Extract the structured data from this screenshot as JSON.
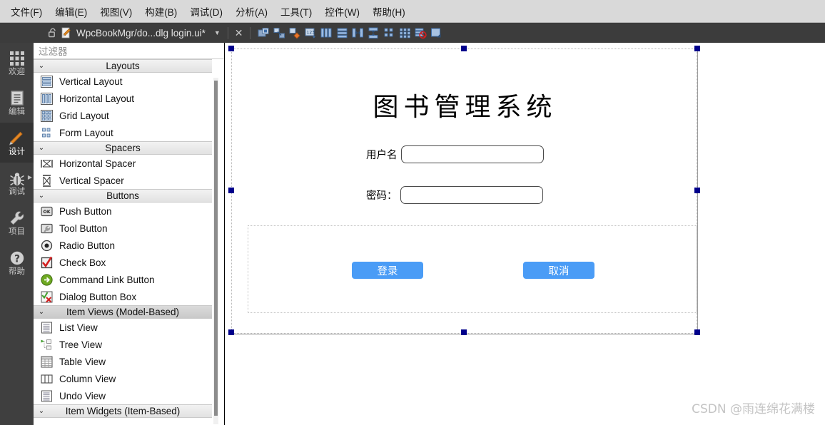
{
  "menubar": [
    {
      "label": "文件(F)"
    },
    {
      "label": "编辑(E)"
    },
    {
      "label": "视图(V)"
    },
    {
      "label": "构建(B)"
    },
    {
      "label": "调试(D)"
    },
    {
      "label": "分析(A)"
    },
    {
      "label": "工具(T)"
    },
    {
      "label": "控件(W)"
    },
    {
      "label": "帮助(H)"
    }
  ],
  "tabbar": {
    "lock_icon": "unlocked-padlock-icon",
    "doc_icon": "edit-document-icon",
    "tab_title": "WpcBookMgr/do...dlg  login.ui*",
    "dropdown_icon": "chevron-down-icon",
    "close_icon": "close-icon",
    "tools": [
      {
        "name": "edit-widgets-icon"
      },
      {
        "name": "edit-signals-slots-icon"
      },
      {
        "name": "edit-buddies-icon"
      },
      {
        "name": "edit-tab-order-icon"
      },
      {
        "name": "layout-horizontally-icon"
      },
      {
        "name": "layout-vertically-icon"
      },
      {
        "name": "layout-horizontal-splitter-icon"
      },
      {
        "name": "layout-vertical-splitter-icon"
      },
      {
        "name": "layout-form-icon"
      },
      {
        "name": "layout-grid-icon"
      },
      {
        "name": "break-layout-icon"
      },
      {
        "name": "adjust-size-icon"
      }
    ]
  },
  "modebar": [
    {
      "label": "欢迎",
      "icon": "grid-welcome-icon",
      "active": false
    },
    {
      "label": "编辑",
      "icon": "document-edit-icon",
      "active": false
    },
    {
      "label": "设计",
      "icon": "pencil-design-icon",
      "active": true
    },
    {
      "label": "调试",
      "icon": "bug-debug-icon",
      "active": false,
      "submenu": true
    },
    {
      "label": "项目",
      "icon": "wrench-projects-icon",
      "active": false
    },
    {
      "label": "帮助",
      "icon": "question-help-icon",
      "active": false
    }
  ],
  "widgetbox": {
    "filter_placeholder": "过滤器",
    "filter_value": "",
    "scrollbar": "vertical-scrollbar",
    "groups": [
      {
        "title": "Layouts",
        "selected": false,
        "expand_icon": "chevron-down-icon",
        "items": [
          {
            "label": "Vertical Layout",
            "icon": "vertical-layout-icon"
          },
          {
            "label": "Horizontal Layout",
            "icon": "horizontal-layout-icon"
          },
          {
            "label": "Grid Layout",
            "icon": "grid-layout-icon"
          },
          {
            "label": "Form Layout",
            "icon": "form-layout-icon"
          }
        ]
      },
      {
        "title": "Spacers",
        "selected": false,
        "expand_icon": "chevron-down-icon",
        "items": [
          {
            "label": "Horizontal Spacer",
            "icon": "horizontal-spacer-icon"
          },
          {
            "label": "Vertical Spacer",
            "icon": "vertical-spacer-icon"
          }
        ]
      },
      {
        "title": "Buttons",
        "selected": false,
        "expand_icon": "chevron-down-icon",
        "items": [
          {
            "label": "Push Button",
            "icon": "push-button-icon"
          },
          {
            "label": "Tool Button",
            "icon": "tool-button-icon"
          },
          {
            "label": "Radio Button",
            "icon": "radio-button-icon"
          },
          {
            "label": "Check Box",
            "icon": "check-box-icon"
          },
          {
            "label": "Command Link Button",
            "icon": "command-link-button-icon"
          },
          {
            "label": "Dialog Button Box",
            "icon": "dialog-button-box-icon"
          }
        ]
      },
      {
        "title": "Item Views (Model-Based)",
        "selected": true,
        "expand_icon": "chevron-down-icon",
        "items": [
          {
            "label": "List View",
            "icon": "list-view-icon"
          },
          {
            "label": "Tree View",
            "icon": "tree-view-icon"
          },
          {
            "label": "Table View",
            "icon": "table-view-icon"
          },
          {
            "label": "Column View",
            "icon": "column-view-icon"
          },
          {
            "label": "Undo View",
            "icon": "undo-view-icon"
          }
        ]
      },
      {
        "title": "Item Widgets (Item-Based)",
        "selected": false,
        "expand_icon": "chevron-down-icon",
        "items": []
      }
    ]
  },
  "canvas": {
    "form_title": "图书管理系统",
    "fields": [
      {
        "label": "用户名",
        "value": "",
        "name": "username"
      },
      {
        "label": "密码：",
        "value": "",
        "name": "password"
      }
    ],
    "buttons": [
      {
        "label": "登录",
        "name": "login",
        "color": "#4a9cf6"
      },
      {
        "label": "取消",
        "name": "cancel",
        "color": "#4a9cf6"
      }
    ],
    "selection_handle_color": "#00008b"
  },
  "watermark": "CSDN @雨连绵花满楼",
  "colors": {
    "menubar_bg": "#d9d9d9",
    "tabstrip_bg": "#3c3c3c",
    "modebar_bg": "#3f3f3f",
    "mode_active_bg": "#333333",
    "accent_button": "#4a9cf6",
    "handle": "#00008b"
  }
}
